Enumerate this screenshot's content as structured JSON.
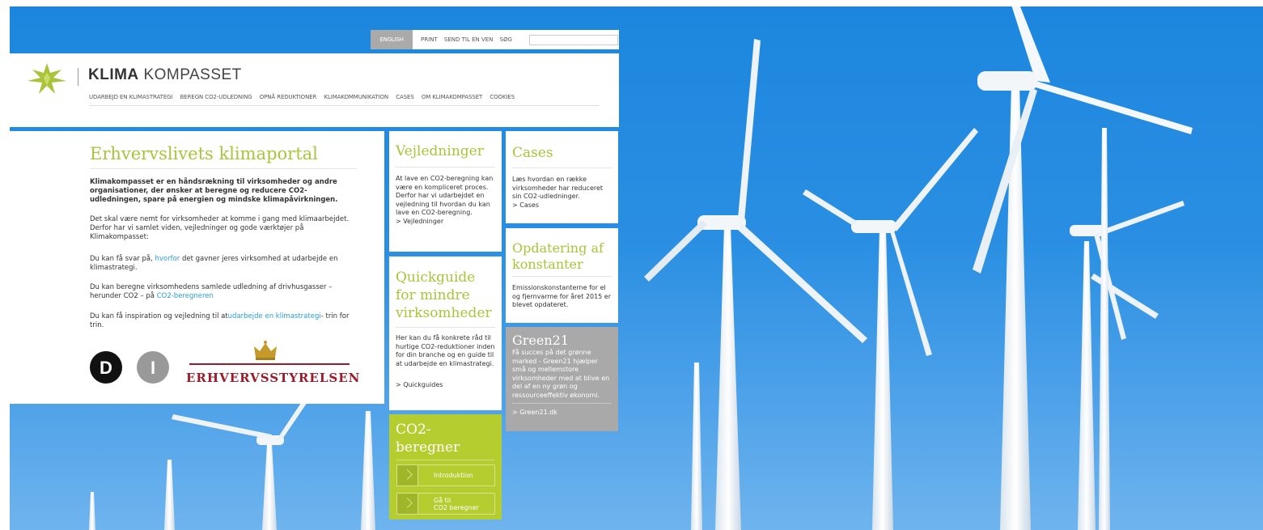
{
  "topbar": {
    "english_label": "ENGLISH",
    "links": [
      "PRINT",
      "SEND TIL EN VEN",
      "SØG"
    ],
    "search_placeholder": ""
  },
  "header": {
    "logo_bold": "KLIMA",
    "logo_light": "KOMPASSET",
    "nav": [
      "UDARBEJD EN KLIMASTRATEGI",
      "BEREGN CO2-UDLEDNING",
      "OPNÅ REDUKTIONER",
      "KLIMAKOMMUNIKATION",
      "CASES",
      "OM KLIMAKOMPASSET",
      "COOKIES"
    ]
  },
  "intro": {
    "title": "Erhvervslivets klimaportal",
    "lead": "Klimakompasset er en håndsrækning til virksomheder og andre organisationer, der ønsker at beregne og reducere CO2-udledningen, spare på energien og mindske klimapåvirkningen.",
    "p1": "Det skal være nemt for virksomheder at komme i gang med klimaarbejdet. Derfor har vi samlet viden, vejledninger og gode værktøjer på Klimakompasset:",
    "p2_pre": "Du kan få svar på,",
    "p2_link": "hvorfor",
    "p2_post": "det gavner jeres virksomhed at udarbejde en klimastrategi.",
    "p3_pre": "Du kan beregne virksomhedens samlede udledning af drivhusgasser – herunder CO2 – på",
    "p3_link": "CO2-beregneren",
    "p4_pre": "Du kan få inspiration og vejledning til at",
    "p4_link": "udarbejde en klimastrategi",
    "p4_post": "- trin for trin.",
    "logo_di_d": "D",
    "logo_di_i": "I",
    "logo_es": "ERHVERVSSTYRELSEN"
  },
  "vejledninger": {
    "title": "Vejledninger",
    "text": "At lave en CO2-beregning kan være en kompliceret proces. Derfor har vi udarbejdet en vejledning til hvordan du kan lave en CO2-beregning.",
    "link": "> Vejledninger"
  },
  "quickguide": {
    "title": "Quickguide for mindre virksomheder",
    "text": "Her kan du få konkrete råd til hurtige CO2-reduktioner inden for din branche og en guide til at udarbejde en klimastrategi.",
    "link": "> Quickguides"
  },
  "cases": {
    "title": "Cases",
    "text": "Læs hvordan en række virksomheder har reduceret sin CO2-udledninger.",
    "link": "> Cases"
  },
  "opdatering": {
    "title": "Opdatering af konstanter",
    "text": "Emissionskonstanterne for el og fjernvarme for året 2015 er blevet opdateret."
  },
  "green21": {
    "title": "Green21",
    "text": "Få succes på det grønne marked - Green21 hjælper små og mellemstore virksomheder med at blive en del af en ny grøn og ressourceeffektiv økonomi.",
    "link": "> Green21.dk"
  },
  "co2": {
    "title": "CO2-beregner",
    "btn1": "Introduktion",
    "btn2_line1": "Gå til",
    "btn2_line2": "CO2 beregner"
  },
  "colors": {
    "accent_green": "#a8c43a",
    "link_blue": "#2a9ed8",
    "sky": "#1c86de",
    "es_red": "#9b1b2a"
  }
}
